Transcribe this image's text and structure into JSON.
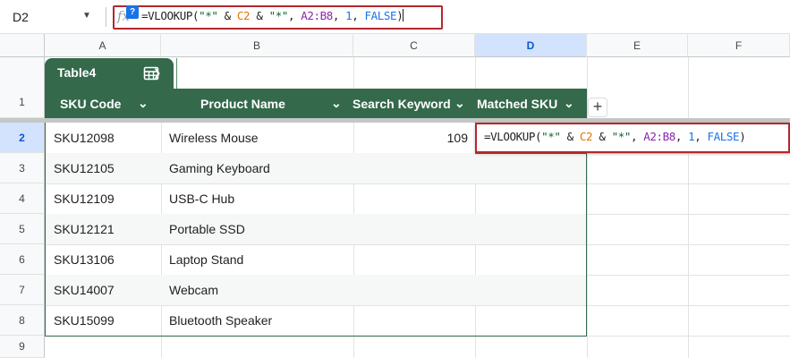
{
  "namebox": {
    "value": "D2"
  },
  "formula_bar": {
    "fx_label": "fx",
    "help_badge": "?",
    "formula_tokens": [
      {
        "text": "=VLOOKUP(",
        "kind": "plain"
      },
      {
        "text": "\"*\"",
        "kind": "str"
      },
      {
        "text": " & ",
        "kind": "plain"
      },
      {
        "text": "C2",
        "kind": "ref1"
      },
      {
        "text": " & ",
        "kind": "plain"
      },
      {
        "text": "\"*\"",
        "kind": "str"
      },
      {
        "text": ", ",
        "kind": "plain"
      },
      {
        "text": "A2:B8",
        "kind": "ref2"
      },
      {
        "text": ", ",
        "kind": "plain"
      },
      {
        "text": "1",
        "kind": "num"
      },
      {
        "text": ", ",
        "kind": "plain"
      },
      {
        "text": "FALSE",
        "kind": "bool"
      },
      {
        "text": ")",
        "kind": "plain"
      }
    ]
  },
  "columns": [
    "A",
    "B",
    "C",
    "D",
    "E",
    "F"
  ],
  "selected_column": "D",
  "rows": [
    "1",
    "2",
    "3",
    "4",
    "5",
    "6",
    "7",
    "8",
    "9"
  ],
  "selected_row": "2",
  "table": {
    "name": "Table4",
    "headers": [
      "SKU Code",
      "Product Name",
      "Search Keyword",
      "Matched SKU"
    ],
    "rows": [
      {
        "sku": "SKU12098",
        "product": "Wireless Mouse",
        "keyword": "109",
        "matched": ""
      },
      {
        "sku": "SKU12105",
        "product": "Gaming Keyboard",
        "keyword": "",
        "matched": ""
      },
      {
        "sku": "SKU12109",
        "product": "USB-C Hub",
        "keyword": "",
        "matched": ""
      },
      {
        "sku": "SKU12121",
        "product": "Portable SSD",
        "keyword": "",
        "matched": ""
      },
      {
        "sku": "SKU13106",
        "product": "Laptop Stand",
        "keyword": "",
        "matched": ""
      },
      {
        "sku": "SKU14007",
        "product": "Webcam",
        "keyword": "",
        "matched": ""
      },
      {
        "sku": "SKU15099",
        "product": "Bluetooth Speaker",
        "keyword": "",
        "matched": ""
      }
    ]
  },
  "colors": {
    "table_header": "#34694b",
    "highlight_border": "#b3282d",
    "selection": "#d3e3fd"
  }
}
